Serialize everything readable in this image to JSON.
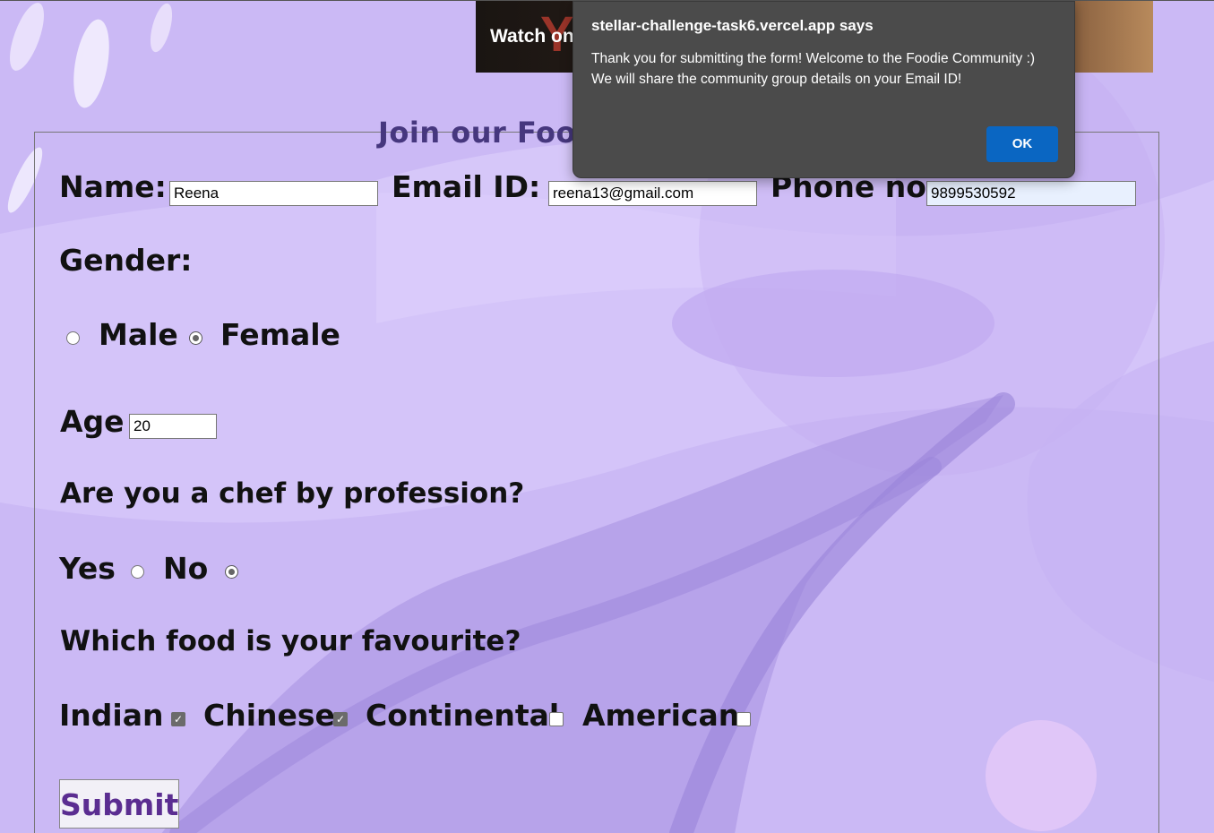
{
  "video_banner": {
    "watch_label": "Watch on",
    "logo_fragment": "Yo"
  },
  "dialog": {
    "title": "stellar-challenge-task6.vercel.app says",
    "message": "Thank you for submitting the form! Welcome to the Foodie Community :) We will share the community group details on your Email ID!",
    "ok_label": "OK"
  },
  "form": {
    "legend": "Join our Food",
    "name_label": "Name:",
    "name_value": "Reena",
    "email_label": "Email ID:",
    "email_value": "reena13@gmail.com",
    "phone_label": "Phone no:",
    "phone_value": "9899530592",
    "gender_label": "Gender:",
    "gender_options": [
      "Male",
      "Female"
    ],
    "gender_selected": "Female",
    "age_label": "Age",
    "age_value": "20",
    "chef_question": "Are you a chef by profession?",
    "chef_options": [
      "Yes",
      "No"
    ],
    "chef_selected": "No",
    "food_question": "Which food is your favourite?",
    "food_options": [
      {
        "label": "Indian",
        "checked": true
      },
      {
        "label": "Chinese",
        "checked": true
      },
      {
        "label": "Continental",
        "checked": false
      },
      {
        "label": "American",
        "checked": false
      }
    ],
    "submit_label": "Submit"
  }
}
